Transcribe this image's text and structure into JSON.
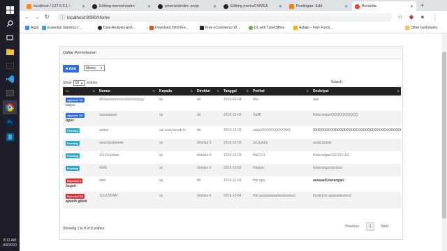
{
  "taskbar": {
    "time": "8:12 AM",
    "date": "8/9/2020"
  },
  "browser": {
    "tabs": [
      {
        "title": "localhost / 127.0.0.1 /",
        "color": "#f29111"
      },
      {
        "title": "Editing memo/readm",
        "color": "#222222"
      },
      {
        "title": "pmens/simlim: proje",
        "color": "#222222"
      },
      {
        "title": "Editing memoC4/REA",
        "color": "#222222"
      },
      {
        "title": "Postingan: Edit",
        "color": "#f57d00"
      },
      {
        "title": "Beranda",
        "color": "#e8453c"
      }
    ],
    "url": "localhost:8080/Home",
    "bookmarks": [
      {
        "label": "Apps",
        "color": "#4285f4"
      },
      {
        "label": "Essential Statistics f...",
        "color": "#3b9edb"
      },
      {
        "label": "Data-Analysis-and-...",
        "color": "#222222"
      },
      {
        "label": "Download 2909 Fre...",
        "color": "#e34c26"
      },
      {
        "label": "Free eCommerce W...",
        "color": "#222222"
      },
      {
        "label": "DL with TubeOffline",
        "color": "#6aa84f"
      },
      {
        "label": "Asbab – Free Furnit...",
        "color": "#f0b400"
      },
      {
        "label": "Other bookmarks",
        "color": "#f0c14b"
      }
    ]
  },
  "card": {
    "title": "Daftar Permohonan",
    "add_label": "Add",
    "type_select": "Memo",
    "show_label": "Show",
    "show_value": "10",
    "entries_label": "entries",
    "search_label": "Search:",
    "columns": [
      "---",
      "Nomor",
      "Kepada",
      "Direktur",
      "Tanggal",
      "Perihal",
      "Deskripsi"
    ],
    "rows": [
      {
        "status": "Approve XX",
        "status_color": "#2e6be6",
        "note": "bagus",
        "note_style": "plain",
        "nomor": "45/xxxxxxxxxxxxxxxxxxxyyyy",
        "kepada": "sp",
        "direktur": "dir",
        "tanggal": "2019-03-04",
        "perihal": "Abc",
        "deskripsi": "aaa",
        "desc_style": "plain"
      },
      {
        "status": "Approve XX",
        "status_color": "#2e6be6",
        "note": "bgus",
        "note_style": "bi",
        "nomor": "aaaaaaaaa",
        "kepada": "sp",
        "direktur": "dir",
        "tanggal": "2019-12-03",
        "perihal": "Halfff",
        "deskripsi": "KeteranganQQQQQQQQQQ",
        "desc_style": "plain"
      },
      {
        "status": "Pending",
        "status_color": "#2aa7c6",
        "note": "",
        "note_style": "plain",
        "nomor": "asdas",
        "kepada": "sal aran kacab ni",
        "direktur": "dir",
        "tanggal": "2019-12-03",
        "perihal": "adasXXXXXXXXXXXXX",
        "deskripsi": "XXXXXXXXXXXXXXXXXXXXXXXXXXXXXXXXXXXXXXXXXX",
        "desc_style": "mixed"
      },
      {
        "status": "Pending",
        "status_color": "#2aa7c6",
        "note": "",
        "note_style": "plain",
        "nomor": "asasUpdateeee",
        "kepada": "sp",
        "direktur": "direktur it",
        "tanggal": "2019-12-09",
        "perihal": "asUpdate",
        "deskripsi": "asdaUpdate",
        "desc_style": "plain"
      },
      {
        "status": "Pending",
        "status_color": "#2aa7c6",
        "note": "",
        "note_style": "plain",
        "nomor": "11111Update",
        "kepada": "sp",
        "direktur": "direktur it",
        "tanggal": "2019-12-03",
        "perihal": "Hal1111",
        "deskripsi": "Keterangan11111111111",
        "desc_style": "plain"
      },
      {
        "status": "Pending",
        "status_color": "#2aa7c6",
        "note": "",
        "note_style": "plain",
        "nomor": "4345",
        "kepada": "sp",
        "direktur": "direktur it",
        "tanggal": "2019-12-03",
        "perihal": "Halada",
        "deskripsi": "Keteranganasdasd",
        "desc_style": "plain"
      },
      {
        "status": "Rejected X",
        "status_color": "#d9303a",
        "note": "begok",
        "note_style": "bi",
        "nomor": "sfas",
        "kepada": "sp",
        "direktur": "dir",
        "tanggal": "2019-12-03",
        "perihal": "Hal apa",
        "deskripsi": "aaaaaaKeterangan",
        "desc_style": "bi"
      },
      {
        "status": "Rejected XX",
        "status_color": "#d9303a",
        "note": "apanih gblok",
        "note_style": "bi",
        "nomor": "1212/SDNR",
        "kepada": "sp",
        "direktur": "direktur it",
        "tanggal": "2019-12-04",
        "perihal": "Hal apaaaaaaadasdasdasd",
        "deskripsi": "Deskripsi apaaadasdasd",
        "desc_style": "plain"
      }
    ],
    "info": "Showing 1 to 8 of 8 entries",
    "pagination": {
      "previous": "Previous",
      "current": "1",
      "next": "Next"
    }
  }
}
